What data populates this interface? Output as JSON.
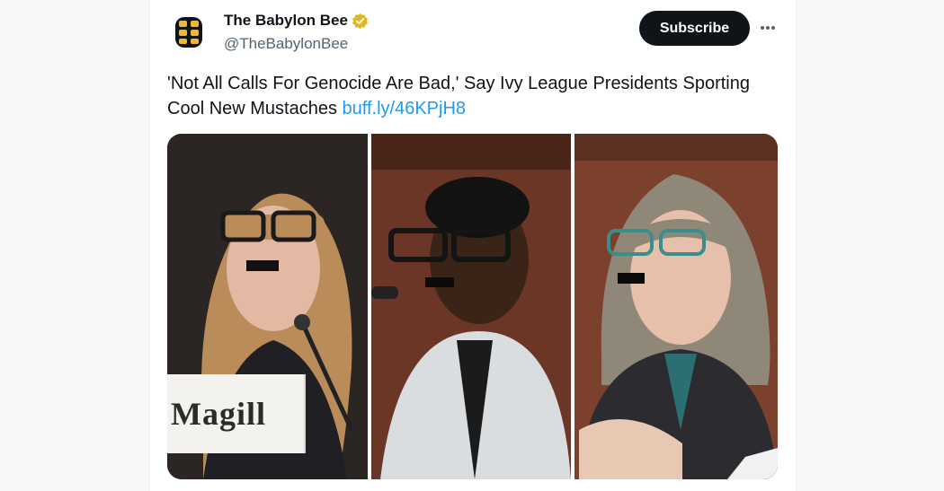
{
  "account": {
    "display_name": "The Babylon Bee",
    "handle": "@TheBabylonBee",
    "verified_badge_icon": "verified-badge-icon",
    "avatar_icon": "bee-logo-icon"
  },
  "actions": {
    "subscribe_label": "Subscribe",
    "more_icon": "more-options-icon"
  },
  "tweet": {
    "text": "'Not All Calls For Genocide Are Bad,' Say Ivy League Presidents Sporting Cool New Mustaches ",
    "link_text": "buff.ly/46KPjH8"
  },
  "media": {
    "nameplate_text": "Magill",
    "panels": [
      "panel-left",
      "panel-middle",
      "panel-right"
    ]
  },
  "colors": {
    "accent_link": "#1d9bf0",
    "verified_gold": "#e2b719",
    "subscribe_bg": "#0f1419",
    "handle_gray": "#536471"
  }
}
